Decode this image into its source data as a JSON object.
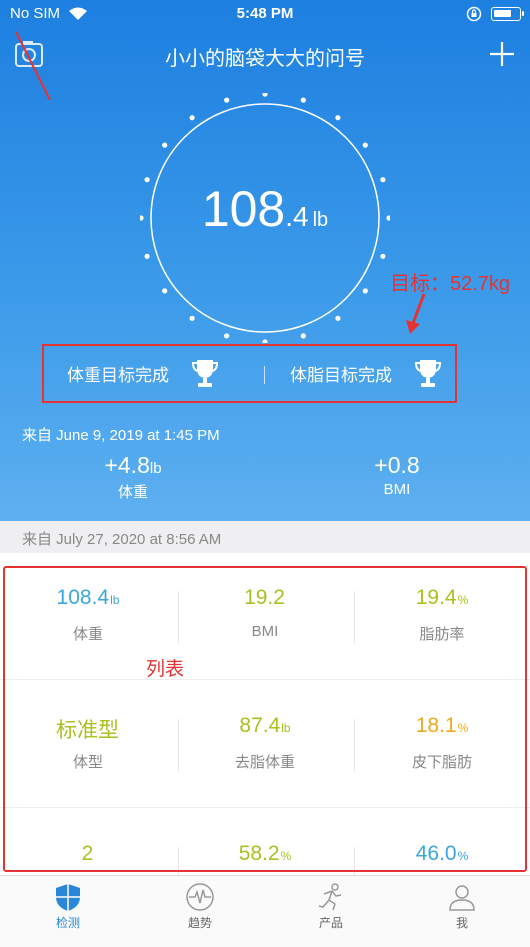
{
  "status_bar": {
    "carrier": "No SIM",
    "time": "5:48 PM"
  },
  "header": {
    "title": "小小的脑袋大大的问号"
  },
  "weight": {
    "int": "108",
    "dec": ".4",
    "unit": "lb"
  },
  "annotations": {
    "goal": "目标：52.7kg",
    "list": "列表"
  },
  "achievements": [
    {
      "label": "体重目标完成"
    },
    {
      "label": "体脂目标完成"
    }
  ],
  "previous": {
    "from": "来自 June 9, 2019 at 1:45 PM",
    "weight_delta": "+4.8",
    "weight_unit": "lb",
    "weight_label": "体重",
    "bmi_delta": "+0.8",
    "bmi_label": "BMI"
  },
  "measurement": {
    "from": "来自 July 27, 2020 at 8:56 AM"
  },
  "metrics": [
    {
      "value": "108.4",
      "unit": "lb",
      "label": "体重",
      "color": "#3aa7dc"
    },
    {
      "value": "19.2",
      "unit": "",
      "label": "BMI",
      "color": "#a8c11f"
    },
    {
      "value": "19.4",
      "unit": "%",
      "label": "脂肪率",
      "color": "#a8c11f"
    },
    {
      "value": "标准型",
      "unit": "",
      "label": "体型",
      "color": "#a8c11f"
    },
    {
      "value": "87.4",
      "unit": "lb",
      "label": "去脂体重",
      "color": "#a8c11f"
    },
    {
      "value": "18.1",
      "unit": "%",
      "label": "皮下脂肪",
      "color": "#f0a81c"
    },
    {
      "value": "2",
      "unit": "",
      "label": "",
      "color": "#a8c11f"
    },
    {
      "value": "58.2",
      "unit": "%",
      "label": "",
      "color": "#a8c11f"
    },
    {
      "value": "46.0",
      "unit": "%",
      "label": "",
      "color": "#3aa7dc"
    }
  ],
  "tabs": [
    {
      "label": "检测",
      "icon": "shield-icon",
      "active": true
    },
    {
      "label": "趋势",
      "icon": "pulse-icon"
    },
    {
      "label": "产品",
      "icon": "runner-icon"
    },
    {
      "label": "我",
      "icon": "person-icon"
    }
  ],
  "colors": {
    "hero_top": "#1d7fe0",
    "accent": "#2a87d8",
    "annotation": "#e53333"
  }
}
